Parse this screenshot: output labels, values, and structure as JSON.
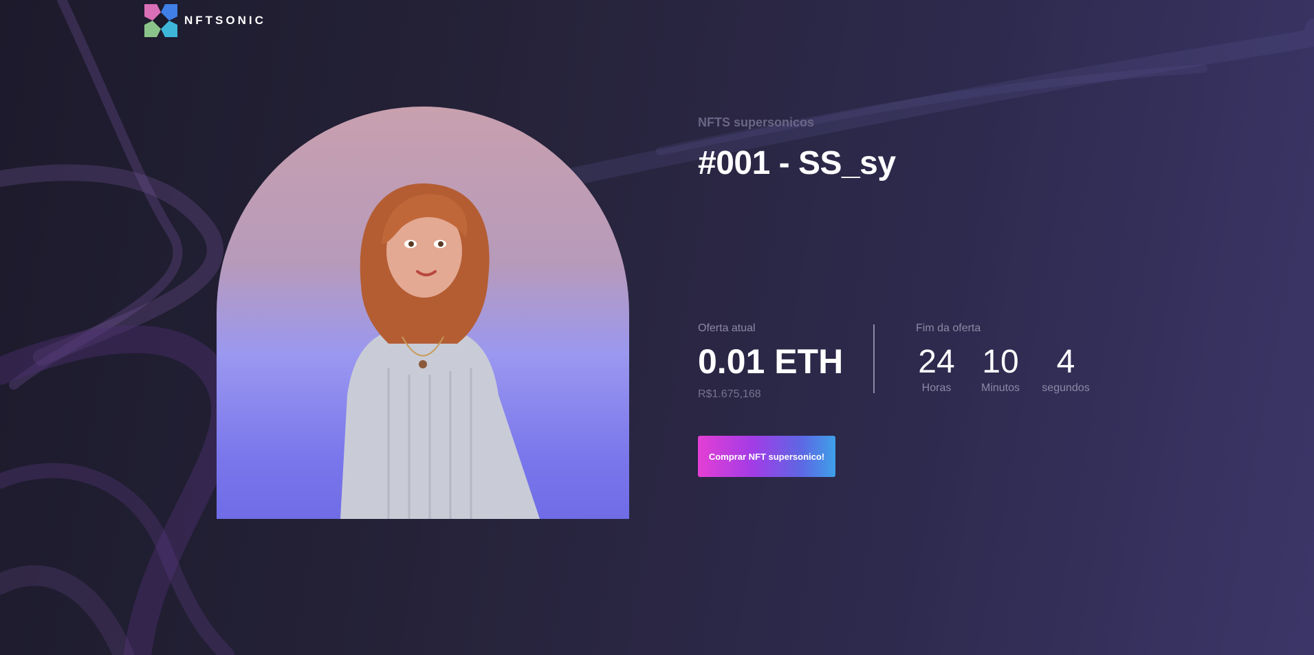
{
  "brand": {
    "name": "NFTSONIC",
    "logo_icon": "nftsonic-x-logo-icon"
  },
  "nft": {
    "collection": "NFTS supersonicos",
    "title": "#001 - SS_sy",
    "image_icon": "character-portrait"
  },
  "offer": {
    "label": "Oferta atual",
    "value": "0.01 ETH",
    "brl_value": "R$1.675,168"
  },
  "countdown": {
    "label": "Fim da oferta",
    "hours": "24",
    "hours_label": "Horas",
    "minutes": "10",
    "minutes_label": "Minutos",
    "seconds": "4",
    "seconds_label": "segundos"
  },
  "buy_button": {
    "label": "Comprar NFT supersonico!"
  },
  "colors": {
    "background_dark": "#1c1a2b",
    "background_light": "#3c3668",
    "button_gradient_start": "#e43fd4",
    "button_gradient_end": "#3ea0e8",
    "art_top": "#c8a0ae",
    "art_bottom": "#6f6ce6"
  }
}
